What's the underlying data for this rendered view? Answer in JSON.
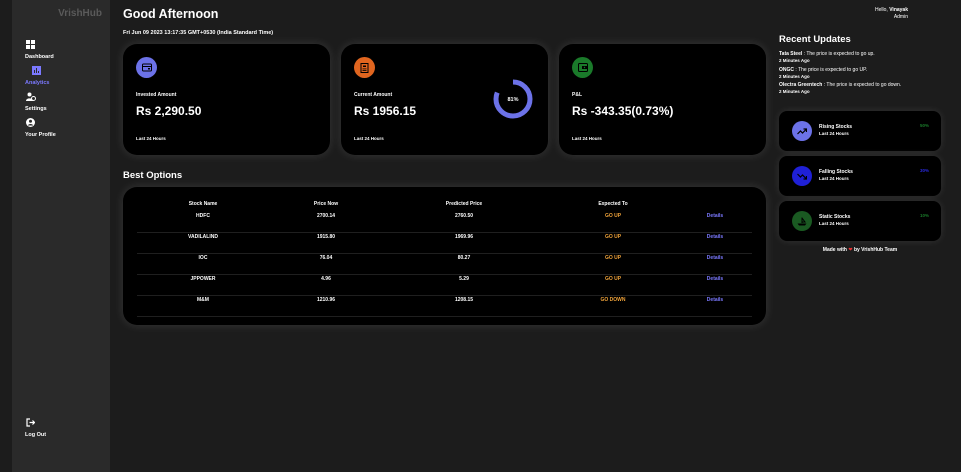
{
  "sidebar": {
    "logo": "VrishHub",
    "items": [
      {
        "label": "Dashboard",
        "icon": "grid-icon"
      },
      {
        "label": "Analytics",
        "icon": "analytics-icon"
      },
      {
        "label": "Settings",
        "icon": "settings-icon"
      },
      {
        "label": "Your Profile",
        "icon": "profile-icon"
      }
    ],
    "logout": "Log Out"
  },
  "header": {
    "greeting": "Good Afternoon",
    "datetime": "Fri Jun 09 2023 13:17:35 GMT+0530 (India Standard Time)",
    "hello": "Hello,",
    "username": "Vinayak",
    "role": "Admin"
  },
  "cards": [
    {
      "label": "Invested Amount",
      "value": "Rs 2,290.50",
      "foot": "Last 24 Hours",
      "color": "#6c72e8"
    },
    {
      "label": "Current Amount",
      "value": "Rs 1956.15",
      "foot": "Last 24 Hours",
      "color": "#e0651f",
      "percent_text": "81%",
      "percent": 81
    },
    {
      "label": "P&L",
      "value": "Rs -343.35(0.73%)",
      "foot": "Last 24 Hours",
      "color": "#1a7a2a"
    }
  ],
  "best_options": {
    "title": "Best Options",
    "headers": [
      "Stock Name",
      "Price Now",
      "Predicted Price",
      "Expected To"
    ],
    "rows": [
      {
        "name": "HDFC",
        "price": "2700.14",
        "predicted": "2760.50",
        "expected": "GO UP",
        "link": "Details"
      },
      {
        "name": "VADILALIND",
        "price": "1915.80",
        "predicted": "1969.96",
        "expected": "GO UP",
        "link": "Details"
      },
      {
        "name": "IOC",
        "price": "76.04",
        "predicted": "80.27",
        "expected": "GO UP",
        "link": "Details"
      },
      {
        "name": "JPPOWER",
        "price": "4.96",
        "predicted": "5.29",
        "expected": "GO UP",
        "link": "Details"
      },
      {
        "name": "M&M",
        "price": "1210.96",
        "predicted": "1208.15",
        "expected": "GO DOWN",
        "link": "Details"
      }
    ]
  },
  "updates": {
    "title": "Recent Updates",
    "items": [
      {
        "stock": "Tata Steel",
        "text": " : The price is expected to go up.",
        "ago": "2 Minutes Ago"
      },
      {
        "stock": "ONGC",
        "text": " : The price is expected to go UP.",
        "ago": "2 Minutes Ago"
      },
      {
        "stock": "Olectra Greentech",
        "text": " : The price is expected to go down.",
        "ago": "2 Minutes Ago"
      }
    ]
  },
  "mini_cards": [
    {
      "title": "Rising Stocks",
      "sub": "Last 24 Hours",
      "pct": "50%",
      "color": "#6c72e8",
      "pct_color": "#1a7a2a"
    },
    {
      "title": "Falling Stocks",
      "sub": "Last 24 Hours",
      "pct": "30%",
      "color": "#1f20d6",
      "pct_color": "#2a2ae0"
    },
    {
      "title": "Static Stocks",
      "sub": "Last 24 Hours",
      "pct": "10%",
      "color": "#1a5a22",
      "pct_color": "#1a7a2a"
    }
  ],
  "footer": {
    "made": "Made with",
    "by": "by VrishHub Team"
  }
}
